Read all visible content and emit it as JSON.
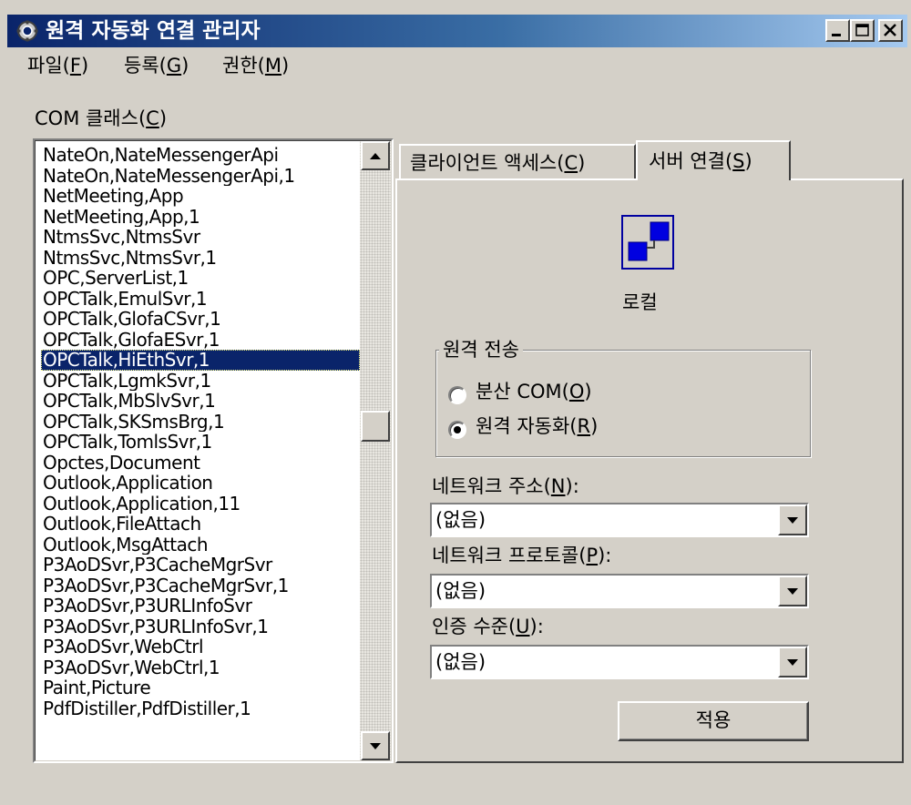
{
  "window": {
    "title": "원격 자동화 연결 관리자"
  },
  "menu": [
    {
      "label": "파일(",
      "key": "F",
      "end": ")"
    },
    {
      "label": "등록(",
      "key": "G",
      "end": ")"
    },
    {
      "label": "권한(",
      "key": "M",
      "end": ")"
    }
  ],
  "com_class": {
    "label": "COM 클래스(",
    "key": "C",
    "end": ")"
  },
  "classes": [
    "NateOn,NateMessengerApi",
    "NateOn,NateMessengerApi,1",
    "NetMeeting,App",
    "NetMeeting,App,1",
    "NtmsSvc,NtmsSvr",
    "NtmsSvc,NtmsSvr,1",
    "OPC,ServerList,1",
    "OPCTalk,EmulSvr,1",
    "OPCTalk,GlofaCSvr,1",
    "OPCTalk,GlofaESvr,1",
    "OPCTalk,HiEthSvr,1",
    "OPCTalk,LgmkSvr,1",
    "OPCTalk,MbSlvSvr,1",
    "OPCTalk,SKSmsBrg,1",
    "OPCTalk,TomlsSvr,1",
    "Opctes,Document",
    "Outlook,Application",
    "Outlook,Application,11",
    "Outlook,FileAttach",
    "Outlook,MsgAttach",
    "P3AoDSvr,P3CacheMgrSvr",
    "P3AoDSvr,P3CacheMgrSvr,1",
    "P3AoDSvr,P3URLInfoSvr",
    "P3AoDSvr,P3URLInfoSvr,1",
    "P3AoDSvr,WebCtrl",
    "P3AoDSvr,WebCtrl,1",
    "Paint,Picture",
    "PdfDistiller,PdfDistiller,1"
  ],
  "selected_class": "OPCTalk,HiEthSvr,1",
  "tabs": [
    {
      "label": "클라이언트 액세스(",
      "key": "C",
      "end": ")"
    },
    {
      "label": "서버 연결(",
      "key": "S",
      "end": ")"
    }
  ],
  "server": {
    "icon_label": "로컬",
    "transport": {
      "title": "원격 전송",
      "options": [
        {
          "label": "분산 COM(",
          "key": "O",
          "end": ")",
          "checked": false
        },
        {
          "label": "원격 자동화(",
          "key": "R",
          "end": ")",
          "checked": true
        }
      ]
    },
    "network_address": {
      "label": "네트워크 주소(",
      "key": "N",
      "end": "):",
      "value": "(없음)"
    },
    "network_protocol": {
      "label": "네트워크 프로토콜(",
      "key": "P",
      "end": "):",
      "value": "(없음)"
    },
    "auth_level": {
      "label": "인증 수준(",
      "key": "U",
      "end": "):",
      "value": "(없음)"
    },
    "apply": "적용"
  }
}
